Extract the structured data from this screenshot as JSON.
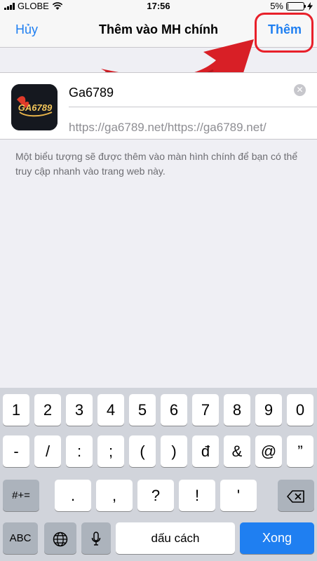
{
  "status_bar": {
    "carrier": "GLOBE",
    "time": "17:56",
    "battery": "5%",
    "battery_level": 0.05
  },
  "nav": {
    "cancel_label": "Hủy",
    "title": "Thêm vào MH chính",
    "add_label": "Thêm"
  },
  "shortcut": {
    "icon_text": "GA6789",
    "name_value": "Ga6789",
    "url": "https://ga6789.net/https://ga6789.net/"
  },
  "hint_text": "Một biểu tượng sẽ được thêm vào màn hình chính để bạn có thể truy cập nhanh vào trang web này.",
  "keyboard": {
    "row1": [
      "1",
      "2",
      "3",
      "4",
      "5",
      "6",
      "7",
      "8",
      "9",
      "0"
    ],
    "row2": [
      "-",
      "/",
      ":",
      ";",
      "(",
      ")",
      "đ",
      "&",
      "@",
      "”"
    ],
    "row3_left": "#+=",
    "row3": [
      ".",
      ",",
      "?",
      "!",
      "'"
    ],
    "abc_label": "ABC",
    "space_label": "dấu cách",
    "return_label": "Xong"
  },
  "colors": {
    "accent": "#1f7ff1",
    "highlight": "#e8202a"
  }
}
